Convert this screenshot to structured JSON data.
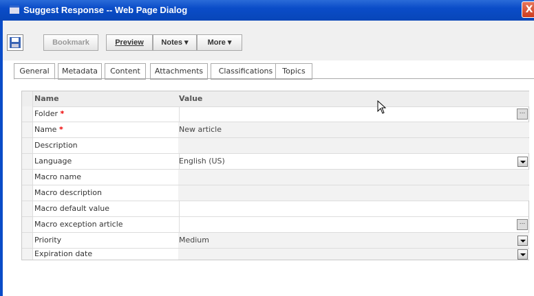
{
  "window": {
    "title": "Suggest Response -- Web Page Dialog",
    "close_glyph": "X"
  },
  "toolbar": {
    "bookmark_label": "Bookmark",
    "preview_label": "Preview",
    "notes_label": "Notes",
    "more_label": "More"
  },
  "tabs": [
    {
      "label": "General",
      "active": true
    },
    {
      "label": "Metadata"
    },
    {
      "label": "Content"
    },
    {
      "label": "Attachments"
    },
    {
      "label": "Classifications"
    },
    {
      "label": "Topics"
    }
  ],
  "grid": {
    "headers": {
      "name": "Name",
      "value": "Value"
    },
    "rows": [
      {
        "name": "Folder",
        "required": "*",
        "value": "",
        "control": "ellipsis"
      },
      {
        "name": "Name",
        "required": "*",
        "value": "New article"
      },
      {
        "name": "Description",
        "value": ""
      },
      {
        "name": "Language",
        "value": "English (US)",
        "control": "dropdown"
      },
      {
        "name": "Macro name",
        "value": ""
      },
      {
        "name": "Macro description",
        "value": ""
      },
      {
        "name": "Macro default value",
        "value": ""
      },
      {
        "name": "Macro exception article",
        "value": "",
        "control": "ellipsis"
      },
      {
        "name": "Priority",
        "value": "Medium",
        "control": "dropdown"
      },
      {
        "name": "Expiration date",
        "value": "",
        "control": "dropdown"
      }
    ]
  },
  "icons": {
    "app": "dialog-icon",
    "save": "save-icon",
    "ellipsis": "...",
    "cursor": "mouse-cursor-icon"
  }
}
